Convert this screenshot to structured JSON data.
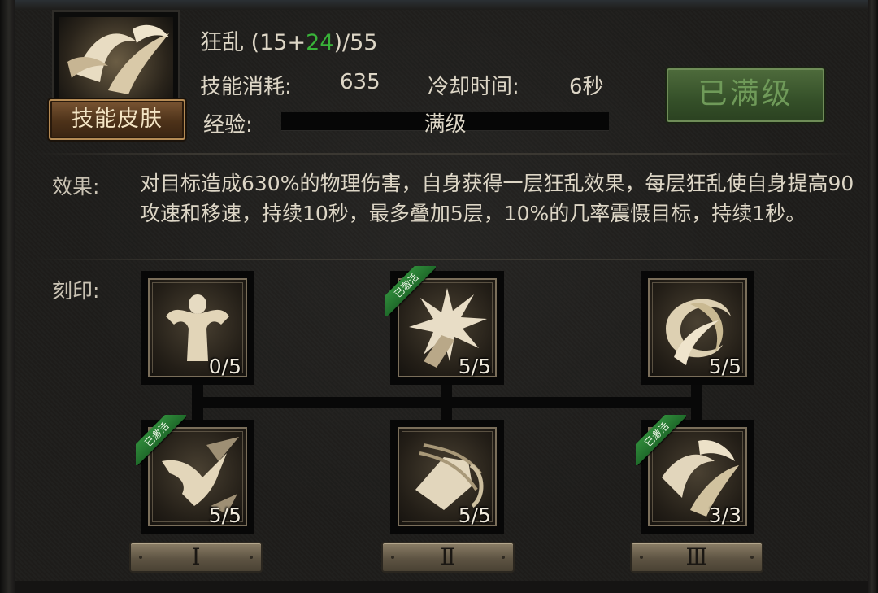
{
  "skill": {
    "name_prefix": "狂乱 (15+",
    "name_bonus": "24",
    "name_suffix": ")/55",
    "cost_label": "技能消耗:",
    "cost_value": "635",
    "cooldown_label": "冷却时间:",
    "cooldown_value": "6秒",
    "exp_label": "经验:",
    "exp_value": "满级",
    "skin_button": "技能皮肤",
    "max_button": "已满级",
    "icon": "swirling-claws-icon"
  },
  "effect": {
    "label": "效果:",
    "text": "对目标造成630%的物理伤害，自身获得一层狂乱效果，每层狂乱使自身提高90攻速和移速，持续10秒，最多叠加5层，10%的几率震慑目标，持续1秒。"
  },
  "runes": {
    "label": "刻印:",
    "ribbon_text": "已激活",
    "top": [
      {
        "count": "0/5",
        "icon": "muscular-body-icon",
        "active": false
      },
      {
        "count": "5/5",
        "icon": "burst-fist-icon",
        "active": true
      },
      {
        "count": "5/5",
        "icon": "whirlwind-icon",
        "active": false
      }
    ],
    "bottom": [
      {
        "count": "5/5",
        "icon": "lunging-figure-icon",
        "active": true
      },
      {
        "count": "5/5",
        "icon": "fist-impact-icon",
        "active": false
      },
      {
        "count": "3/3",
        "icon": "swirling-claws-icon",
        "active": true
      }
    ],
    "tiers": [
      "Ⅰ",
      "Ⅱ",
      "Ⅲ"
    ]
  }
}
